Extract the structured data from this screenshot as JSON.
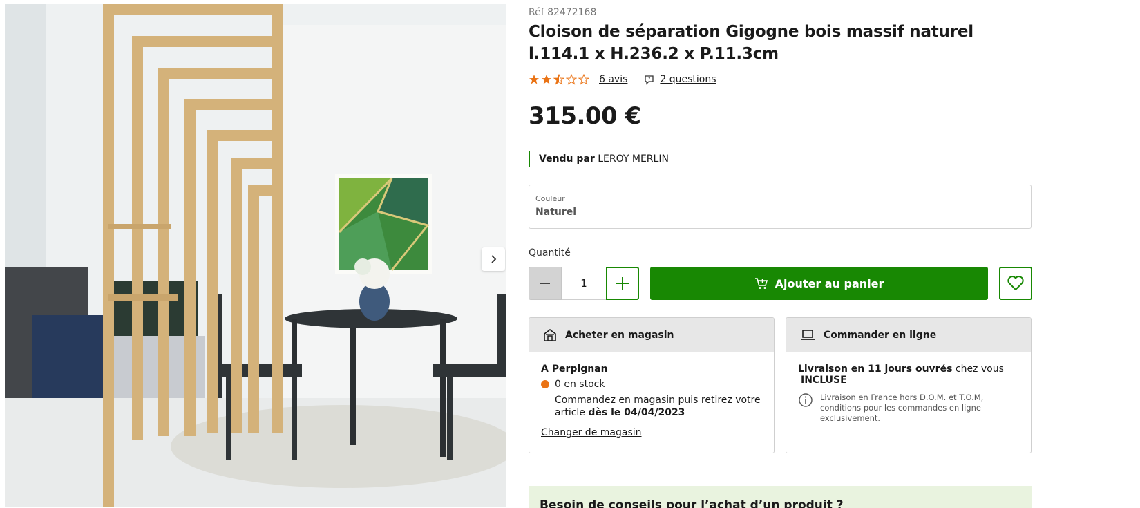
{
  "product": {
    "ref": "Réf 82472168",
    "title": "Cloison de séparation Gigogne bois massif naturel l.114.1 x H.236.2 x P.11.3cm",
    "rating": 2.5,
    "rating_max": 5,
    "reviews_link": "6 avis",
    "questions_link": "2 questions",
    "price": "315.00 €",
    "seller_prefix": "Vendu par",
    "seller_name": "LEROY MERLIN"
  },
  "gallery": {
    "next_icon": "chevron-right-icon"
  },
  "color_select": {
    "label": "Couleur",
    "value": "Naturel"
  },
  "quantity": {
    "label": "Quantité",
    "value": "1"
  },
  "actions": {
    "add_to_cart": "Ajouter au panier"
  },
  "store_card": {
    "title": "Acheter en magasin",
    "store": "A Perpignan",
    "stock": "0 en stock",
    "note_prefix": "Commandez en magasin puis retirez votre article",
    "note_date": "dès le 04/04/2023",
    "change_link": "Changer de magasin"
  },
  "online_card": {
    "title": "Commander en ligne",
    "delivery_bold": "Livraison en 11 jours ouvrés",
    "delivery_suffix": "chez vous",
    "included": "INCLUSE",
    "note": "Livraison en France hors D.O.M. et T.O.M, conditions pour les commandes en ligne exclusivement."
  },
  "advice_banner": {
    "title": "Besoin de conseils pour l’achat d’un produit ?"
  },
  "colors": {
    "brand_green": "#188803",
    "star_orange": "#ea7315",
    "stock_dot": "#ea7315"
  }
}
